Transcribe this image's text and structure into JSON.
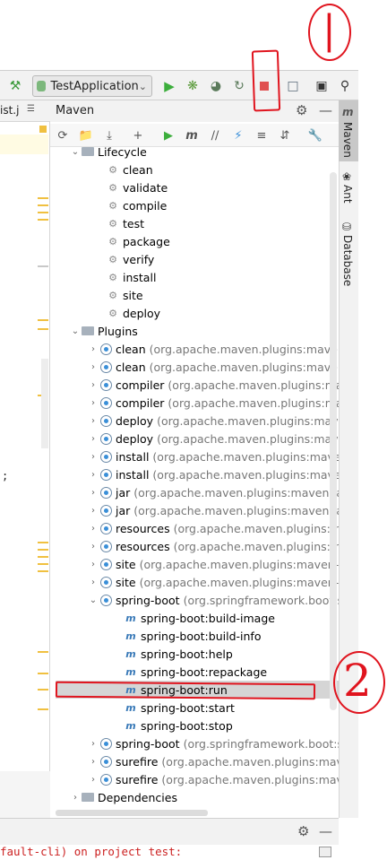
{
  "toolbar": {
    "run_config": "TestApplication",
    "icons": [
      "hammer-icon",
      "run-icon",
      "debug-icon",
      "coverage-icon",
      "profile-icon",
      "stop-icon",
      "project-structure-icon",
      "terminal-icon",
      "search-icon"
    ]
  },
  "editor": {
    "tab_label": "ist.j",
    "tab_menu": "☰",
    "code_fragment": ";"
  },
  "maven": {
    "title": "Maven",
    "tree": {
      "lifecycle_label": "Lifecycle",
      "lifecycle_items": [
        "clean",
        "validate",
        "compile",
        "test",
        "package",
        "verify",
        "install",
        "site",
        "deploy"
      ],
      "plugins_label": "Plugins",
      "plugins": [
        {
          "name": "clean",
          "detail": "(org.apache.maven.plugins:maven-c"
        },
        {
          "name": "clean",
          "detail": "(org.apache.maven.plugins:maven-c"
        },
        {
          "name": "compiler",
          "detail": "(org.apache.maven.plugins:mave"
        },
        {
          "name": "compiler",
          "detail": "(org.apache.maven.plugins:mave"
        },
        {
          "name": "deploy",
          "detail": "(org.apache.maven.plugins:maven"
        },
        {
          "name": "deploy",
          "detail": "(org.apache.maven.plugins:maven"
        },
        {
          "name": "install",
          "detail": "(org.apache.maven.plugins:maven-i"
        },
        {
          "name": "install",
          "detail": "(org.apache.maven.plugins:maven-i"
        },
        {
          "name": "jar",
          "detail": "(org.apache.maven.plugins:maven-jar-"
        },
        {
          "name": "jar",
          "detail": "(org.apache.maven.plugins:maven-jar-"
        },
        {
          "name": "resources",
          "detail": "(org.apache.maven.plugins:mav"
        },
        {
          "name": "resources",
          "detail": "(org.apache.maven.plugins:mav"
        },
        {
          "name": "site",
          "detail": "(org.apache.maven.plugins:maven-site"
        },
        {
          "name": "site",
          "detail": "(org.apache.maven.plugins:maven-site"
        },
        {
          "name": "spring-boot",
          "detail": "(org.springframework.boot:s"
        }
      ],
      "spring_boot_goals": [
        "spring-boot:build-image",
        "spring-boot:build-info",
        "spring-boot:help",
        "spring-boot:repackage",
        "spring-boot:run",
        "spring-boot:start",
        "spring-boot:stop"
      ],
      "plugins_after": [
        {
          "name": "spring-boot",
          "detail": "(org.springframework.boot:s"
        },
        {
          "name": "surefire",
          "detail": "(org.apache.maven.plugins:maver"
        },
        {
          "name": "surefire",
          "detail": "(org.apache.maven.plugins:maver"
        }
      ],
      "dependencies_label": "Dependencies"
    }
  },
  "side_tabs": [
    "Maven",
    "Ant",
    "Database"
  ],
  "console_text": "fault-cli) on project test:",
  "annotations": {
    "one": "①",
    "two": "2"
  },
  "colors": {
    "annotation": "#e0141e",
    "run": "#3cae3c",
    "stop": "#e05050"
  }
}
